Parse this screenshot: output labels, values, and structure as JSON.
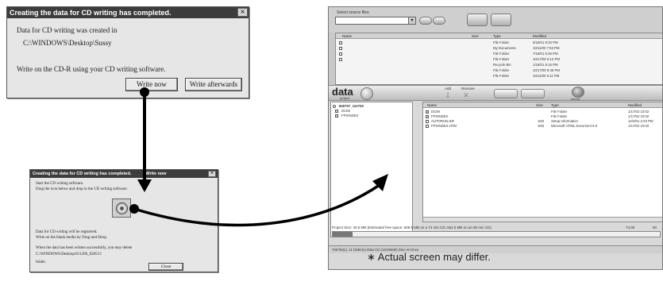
{
  "dialog_complete": {
    "title": "Creating the data for CD writing has completed.",
    "close": "×",
    "line1": "Data for CD writing was created in",
    "path": "C:\\WINDOWS\\Desktop\\Sussy",
    "line2": "Write on the CD-R using your CD writing software.",
    "write_now": "Write now",
    "write_afterwards": "Write afterwards"
  },
  "dialog_write_now": {
    "title": "Creating the data for CD writing has completed.",
    "title_tail": "Write now",
    "close": "×",
    "line1": "Start the CD writing software.",
    "line2": "Drag the icon below and drop to the CD writing software.",
    "line3": "Data for CD writing will be registered.",
    "line4": "Write on the blank media by Drag-and-Drop.",
    "line5": "When the data has been written successfully, you may delete",
    "path": "C:\\WINDOWS\\Desktop\\011206_020513",
    "folder": "folder.",
    "close_button": "Close"
  },
  "app": {
    "select_source_label": "Select source files",
    "top_list_headers": [
      "Name",
      "Size",
      "Type",
      "Modified"
    ],
    "top_list_rows": [
      {
        "type": "File Folder",
        "modified": "6/16/01 9:33 PM"
      },
      {
        "type": "My Documents",
        "modified": "10/11/00 7:53 PM"
      },
      {
        "type": "File Folder",
        "modified": "7/16/01 5:46 PM"
      },
      {
        "type": "File Folder",
        "modified": "10/17/00 6:12 PM"
      },
      {
        "type": "Recycle Bin",
        "modified": "1/16/01 5:15 PM"
      },
      {
        "type": "File Folder",
        "modified": "10/17/00 9:46 PM"
      },
      {
        "type": "File Folder",
        "modified": "10/11/00 6:11 PM"
      }
    ],
    "brand": "data",
    "brand_sub": "project",
    "toolbar_labels": [
      "Add",
      "Remove"
    ],
    "record_label": "record",
    "tree": [
      "840797_112705",
      "DCIM",
      "FPXINDEX"
    ],
    "file_headers": [
      "Name",
      "Size",
      "Type",
      "Modified"
    ],
    "files": [
      {
        "name": "DCIM",
        "size": "",
        "type": "File Folder",
        "modified": "1/17/02 10:02"
      },
      {
        "name": "FPXINDEX",
        "size": "",
        "type": "File Folder",
        "modified": "1/17/02 10:02"
      },
      {
        "name": "AUTORUN.INF",
        "size": "1KB",
        "type": "Setup Information",
        "modified": "12/2/01 2:23 PM"
      },
      {
        "name": "FPXINDEX.HTM",
        "size": "1KB",
        "type": "Microsoft HTML Document 5.0",
        "modified": "1/17/02 10:02"
      }
    ],
    "status_project_size": "Project Size: 40.5 MB   (Estimated free space: 609.9 MB on a 74 min CD;  662.5 MB on an 80 min CD)",
    "status_right_a": "74:00",
    "status_right_b": "80",
    "status_bar": "709 file(s), 11 folder(s)   Data CD (1SO9660)   Disc-At-Once"
  },
  "note": "∗ Actual screen may differ."
}
